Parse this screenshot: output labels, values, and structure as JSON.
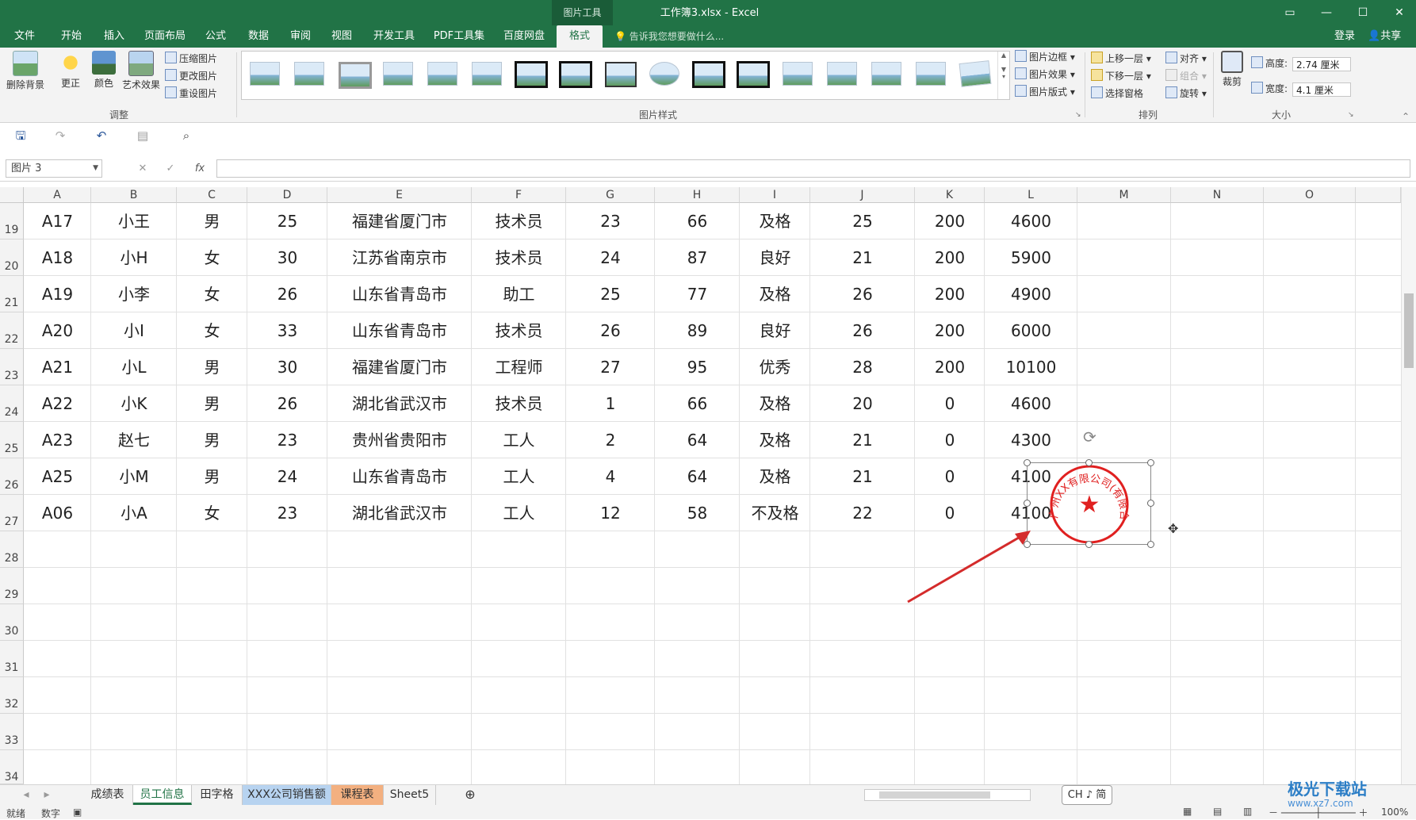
{
  "window": {
    "context_tools": "图片工具",
    "title": "工作簿3.xlsx - Excel",
    "buttons": [
      "▭",
      "—",
      "☐",
      "✕"
    ]
  },
  "tabs": [
    "文件",
    "开始",
    "插入",
    "页面布局",
    "公式",
    "数据",
    "审阅",
    "视图",
    "开发工具",
    "PDF工具集",
    "百度网盘",
    "格式"
  ],
  "active_tab": "格式",
  "tell_me": "告诉我您想要做什么...",
  "account": {
    "login": "登录",
    "share": "共享"
  },
  "ribbon": {
    "remove_bg": "删除背景",
    "corrections": "更正",
    "color": "颜色",
    "artistic": "艺术效果",
    "compress": "压缩图片",
    "change": "更改图片",
    "reset": "重设图片",
    "adjust_group": "调整",
    "styles_group": "图片样式",
    "border": "图片边框",
    "effects": "图片效果",
    "layout": "图片版式",
    "bring_forward": "上移一层",
    "send_backward": "下移一层",
    "selection_pane": "选择窗格",
    "align": "对齐",
    "group": "组合",
    "rotate": "旋转",
    "arrange_group": "排列",
    "crop": "裁剪",
    "height_label": "高度:",
    "height_value": "2.74 厘米",
    "width_label": "宽度:",
    "width_value": "4.1 厘米",
    "size_group": "大小"
  },
  "formula_bar": {
    "name_box": "图片 3",
    "fx": "fx",
    "value": ""
  },
  "columns": [
    "A",
    "B",
    "C",
    "D",
    "E",
    "F",
    "G",
    "H",
    "I",
    "J",
    "K",
    "L",
    "M",
    "N",
    "O"
  ],
  "rows": [
    {
      "num": "19",
      "cells": [
        "A17",
        "小王",
        "男",
        "25",
        "福建省厦门市",
        "技术员",
        "23",
        "66",
        "及格",
        "25",
        "200",
        "4600"
      ]
    },
    {
      "num": "20",
      "cells": [
        "A18",
        "小H",
        "女",
        "30",
        "江苏省南京市",
        "技术员",
        "24",
        "87",
        "良好",
        "21",
        "200",
        "5900"
      ]
    },
    {
      "num": "21",
      "cells": [
        "A19",
        "小李",
        "女",
        "26",
        "山东省青岛市",
        "助工",
        "25",
        "77",
        "及格",
        "26",
        "200",
        "4900"
      ]
    },
    {
      "num": "22",
      "cells": [
        "A20",
        "小I",
        "女",
        "33",
        "山东省青岛市",
        "技术员",
        "26",
        "89",
        "良好",
        "26",
        "200",
        "6000"
      ]
    },
    {
      "num": "23",
      "cells": [
        "A21",
        "小L",
        "男",
        "30",
        "福建省厦门市",
        "工程师",
        "27",
        "95",
        "优秀",
        "28",
        "200",
        "10100"
      ]
    },
    {
      "num": "24",
      "cells": [
        "A22",
        "小K",
        "男",
        "26",
        "湖北省武汉市",
        "技术员",
        "1",
        "66",
        "及格",
        "20",
        "0",
        "4600"
      ]
    },
    {
      "num": "25",
      "cells": [
        "A23",
        "赵七",
        "男",
        "23",
        "贵州省贵阳市",
        "工人",
        "2",
        "64",
        "及格",
        "21",
        "0",
        "4300"
      ]
    },
    {
      "num": "26",
      "cells": [
        "A25",
        "小M",
        "男",
        "24",
        "山东省青岛市",
        "工人",
        "4",
        "64",
        "及格",
        "21",
        "0",
        "4100"
      ]
    },
    {
      "num": "27",
      "cells": [
        "A06",
        "小A",
        "女",
        "23",
        "湖北省武汉市",
        "工人",
        "12",
        "58",
        "不及格",
        "22",
        "0",
        "4100"
      ]
    },
    {
      "num": "28",
      "cells": []
    },
    {
      "num": "29",
      "cells": []
    },
    {
      "num": "30",
      "cells": []
    },
    {
      "num": "31",
      "cells": []
    },
    {
      "num": "32",
      "cells": []
    },
    {
      "num": "33",
      "cells": []
    },
    {
      "num": "34",
      "cells": []
    }
  ],
  "seal": {
    "text": "广州XX有限公司(有限合伙)",
    "star": "★",
    "color": "#e02020"
  },
  "sheets": [
    "成绩表",
    "员工信息",
    "田字格",
    "XXX公司销售额",
    "课程表",
    "Sheet5"
  ],
  "active_sheet": "员工信息",
  "ime": "CH ♪ 简",
  "status": {
    "ready": "就绪",
    "mode": "数字",
    "zoom": "100%"
  },
  "watermark": {
    "title": "极光下载站",
    "url": "www.xz7.com"
  },
  "colors": {
    "excel_green": "#217346",
    "seal_red": "#e02020",
    "arrow_red": "#d42b2b"
  }
}
